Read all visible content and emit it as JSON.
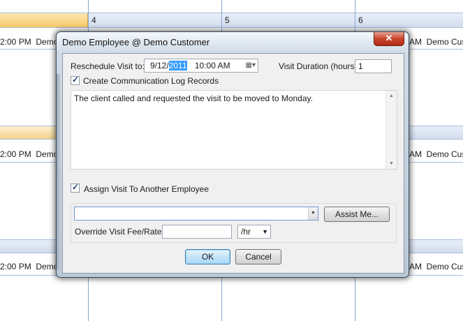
{
  "calendar": {
    "day_numbers": [
      "4",
      "5",
      "6"
    ],
    "appointments": [
      {
        "time": "2:00 PM",
        "name": "Demo",
        "right_name": "AM",
        "right_text": "Demo Custo"
      },
      {
        "time": "2:00 PM",
        "name": "Demo",
        "right_name": "AM",
        "right_text": "Demo Custo"
      },
      {
        "time": "2:00 PM",
        "name": "Demo",
        "right_name": "AM",
        "right_text": "Demo Custo"
      }
    ]
  },
  "dialog": {
    "title": "Demo Employee @ Demo Customer",
    "close_label": "✕",
    "reschedule_label": "Reschedule Visit to:",
    "date_prefix": "9/12/",
    "date_year": "2011",
    "time_value": "10:00 AM",
    "duration_label": "Visit Duration (hours):",
    "duration_value": "1",
    "comm_log_label": "Create Communication Log Records",
    "comm_log_checked": true,
    "memo_text": "The client called and requested the visit to be moved to Monday.",
    "assign_label": "Assign Visit To Another Employee",
    "assign_checked": true,
    "employee_value": "",
    "assist_label": "Assist Me...",
    "override_label": "Override Visit Fee/Rate:",
    "override_value": "",
    "rate_unit": "/hr",
    "ok_label": "OK",
    "cancel_label": "Cancel"
  },
  "colors": {
    "accent": "#3399ff",
    "close_red": "#c9452c",
    "calendar_line": "#8aa7d3",
    "today_highlight": "#f6c96a"
  }
}
